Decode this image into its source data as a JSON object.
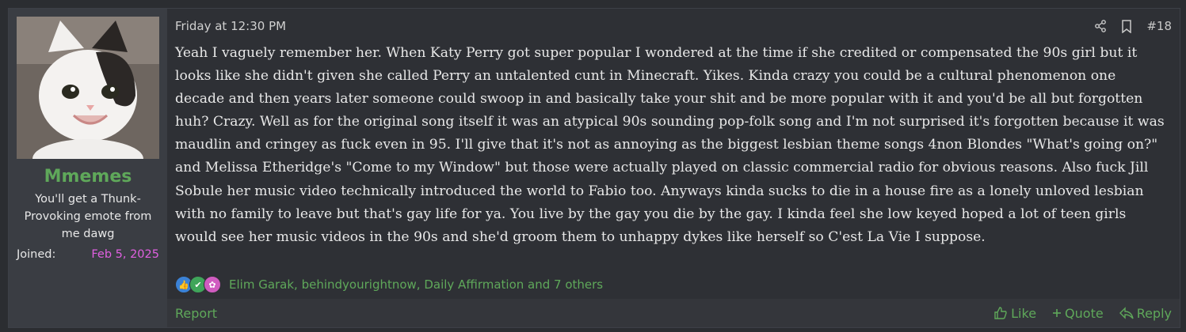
{
  "user": {
    "username": "Mmemes",
    "title": "You'll get a Thunk-Provoking emote from me dawg",
    "joined_label": "Joined:",
    "joined_date": "Feb 5, 2025"
  },
  "post": {
    "date": "Friday at 12:30 PM",
    "number": "#18",
    "body": "Yeah I vaguely remember her. When Katy Perry got super popular I wondered at the time if she credited or compensated the 90s girl but it looks like she didn't given she called Perry an untalented cunt in Minecraft. Yikes. Kinda crazy you could be a cultural phenomenon one decade and then years later someone could swoop in and basically take your shit and be more popular with it and you'd be all but forgotten huh? Crazy. Well as for the original song itself it was an atypical 90s sounding pop-folk song and I'm not surprised it's forgotten because it was maudlin and cringey as fuck even in 95. I'll give that it's not as annoying as the biggest lesbian theme songs 4non Blondes \"What's going on?\" and Melissa Etheridge's \"Come to my Window\" but those were actually played on classic commercial radio for obvious reasons. Also fuck Jill Sobule her music video technically introduced the world to Fabio too. Anyways kinda sucks to die in a house fire as a lonely unloved lesbian with no family to leave but that's gay life for ya. You live by the gay you die by the gay. I kinda feel she low keyed hoped a lot of teen girls would see her music videos in the 90s and she'd groom them to unhappy dykes like herself so C'est La Vie I suppose."
  },
  "reactions": {
    "icons": [
      "thumbs-up-reaction-icon",
      "check-reaction-icon",
      "puzzle-reaction-icon"
    ],
    "names": "Elim Garak, behindyourightnow, Daily Affirmation and 7 others"
  },
  "footer": {
    "report": "Report",
    "like": "Like",
    "quote": "Quote",
    "reply": "Reply"
  },
  "colors": {
    "accent": "#5fa85a",
    "joined_date": "#e060e0"
  }
}
